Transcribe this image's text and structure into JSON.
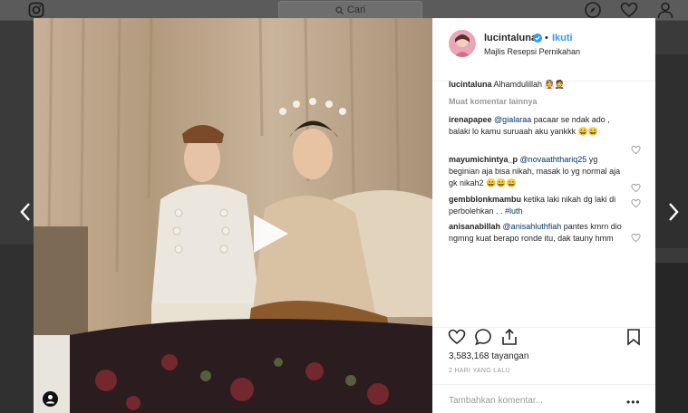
{
  "topbar": {
    "search_placeholder": "Cari"
  },
  "post": {
    "username": "lucintaluna",
    "follow_label": "Ikuti",
    "dot": "•",
    "location": "Majlis Resepsi Pernikahan",
    "caption_user": "lucintaluna",
    "caption_text": "Alhamdulillah 👰🤵",
    "more_comments": "Muat komentar lainnya",
    "comments": [
      {
        "user": "irenapapee",
        "mention": "@gialaraa",
        "text": " pacaar se ndak ado , balaki lo kamu suruaah aku yankkk 😄😄"
      },
      {
        "user": "mayumichintya_p",
        "mention": "@novaaththariq25",
        "text": " yg beginian aja bisa nikah, masak lo yg normal aja gk nikah2 😄😄😄"
      },
      {
        "user": "gembblonkmambu",
        "mention": "",
        "text": " ketika laki nikah dg laki di perbolehkan . . ",
        "tag": "#luth"
      },
      {
        "user": "anisanabillah",
        "mention": "@anisahluthfiah",
        "text": " pantes kmrn dio ngmng kuat berapo ronde itu, dak tauny hmm"
      }
    ],
    "views": "3,583,168 tayangan",
    "date": "2 HARI YANG LALU",
    "add_comment_placeholder": "Tambahkan komentar...",
    "options": "•••"
  },
  "colors": {
    "link": "#3897f0",
    "text": "#262626",
    "muted": "#999999"
  },
  "icons": [
    "instagram-icon",
    "search-icon",
    "compass-icon",
    "heart-icon",
    "profile-icon",
    "chevron-left-icon",
    "chevron-right-icon",
    "play-icon",
    "sound-icon",
    "verified-icon",
    "comment-icon",
    "share-icon",
    "bookmark-icon"
  ]
}
